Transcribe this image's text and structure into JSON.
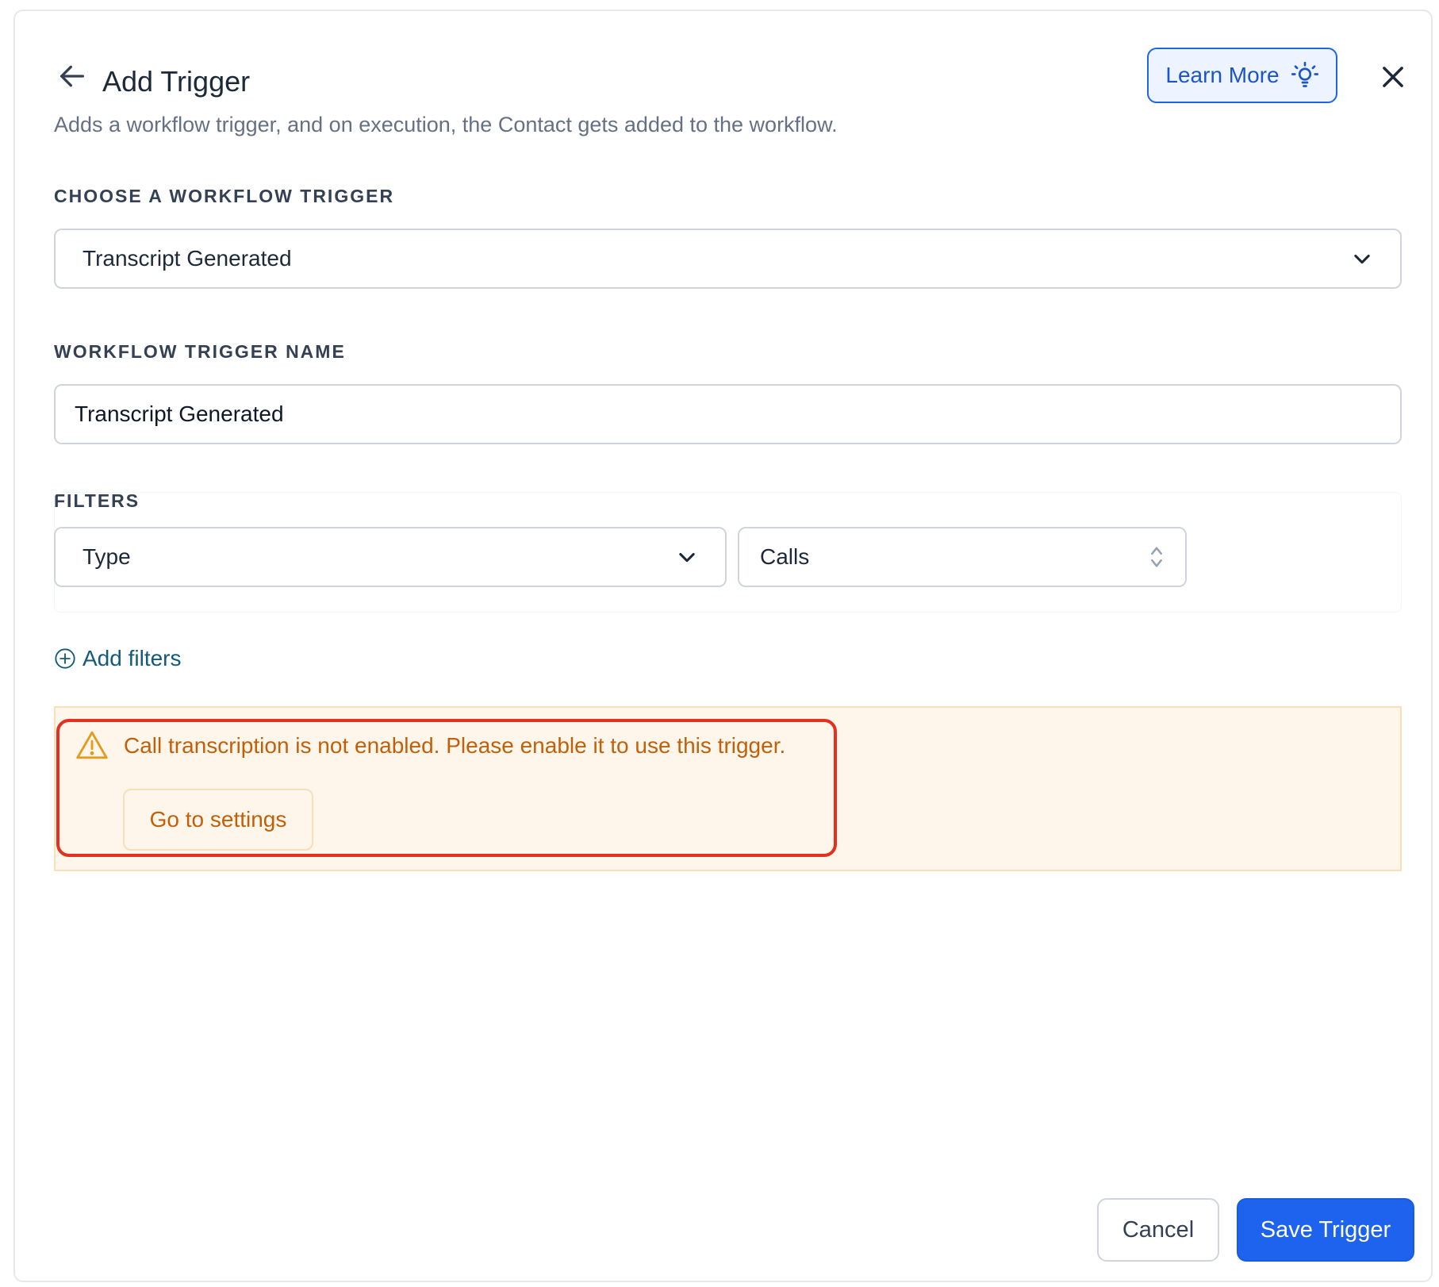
{
  "header": {
    "title": "Add Trigger",
    "subtitle": "Adds a workflow trigger, and on execution, the Contact gets added to the workflow.",
    "learn_more_label": "Learn More"
  },
  "trigger_select": {
    "label": "CHOOSE A WORKFLOW TRIGGER",
    "value": "Transcript Generated"
  },
  "trigger_name": {
    "label": "WORKFLOW TRIGGER NAME",
    "value": "Transcript Generated"
  },
  "filters": {
    "label": "FILTERS",
    "field_value": "Type",
    "operand_value": "Calls",
    "add_label": "Add filters"
  },
  "warning": {
    "message": "Call transcription is not enabled. Please enable it to use this trigger.",
    "action_label": "Go to settings"
  },
  "footer": {
    "cancel_label": "Cancel",
    "save_label": "Save Trigger"
  },
  "colors": {
    "primary": "#1d63ed",
    "warning_text": "#c2600a",
    "warning_bg": "#fef6eb",
    "highlight_border": "#e4301c",
    "link": "#155a7a"
  }
}
